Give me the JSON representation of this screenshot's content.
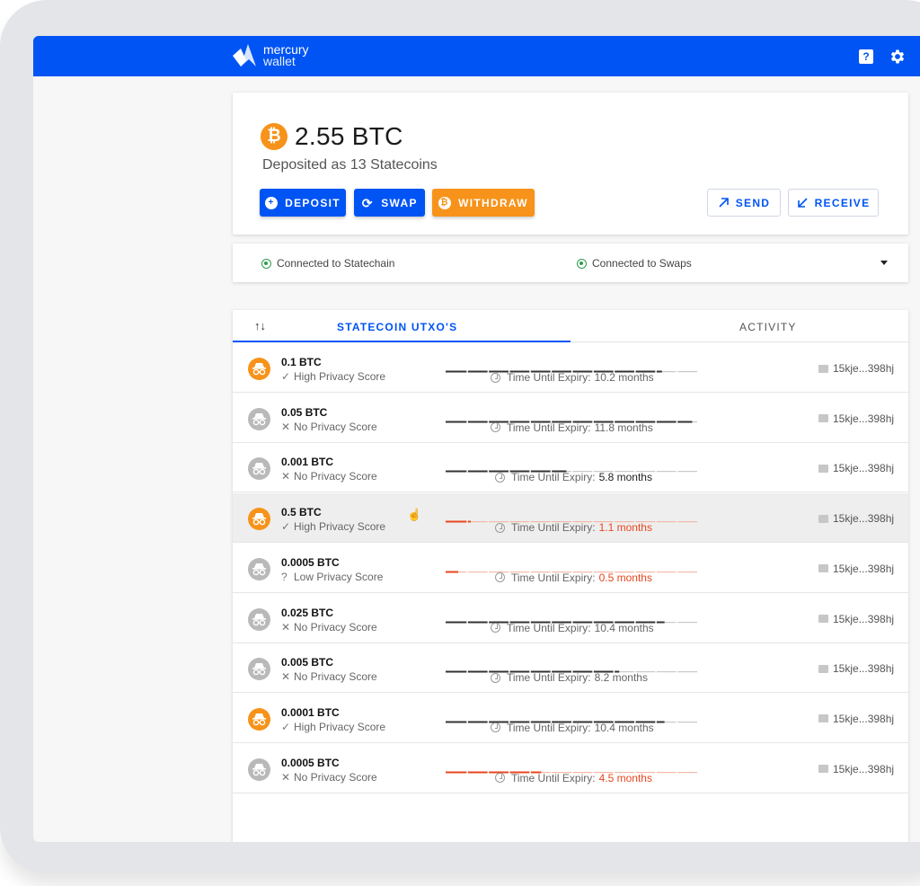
{
  "app": {
    "logo_line1": "mercury",
    "logo_line2": "wallet",
    "help_label": "?"
  },
  "balance": {
    "amount": "2.55 BTC",
    "subtitle": "Deposited as 13 Statecoins",
    "btc_symbol": "₿"
  },
  "actions": {
    "deposit": "DEPOSIT",
    "swap": "SWAP",
    "withdraw": "WITHDRAW",
    "send": "SEND",
    "receive": "RECEIVE"
  },
  "status": {
    "statechain": "Connected to Statechain",
    "swaps": "Connected to Swaps"
  },
  "tabs": {
    "sort_icon": "↑↓",
    "utxo": "STATECOIN UTXO'S",
    "activity": "ACTIVITY"
  },
  "expiry_label": "Time Until Expiry:",
  "coins": [
    {
      "amount": "0.1 BTC",
      "privacy_icon": "✓",
      "privacy": "High Privacy Score",
      "icon_color": "orange",
      "expiry": "10.2 months",
      "expiry_style": "normal",
      "progress": 0.86,
      "bar_color": "dark",
      "address": "15kje...398hj"
    },
    {
      "amount": "0.05 BTC",
      "privacy_icon": "✕",
      "privacy": "No Privacy Score",
      "icon_color": "grey",
      "expiry": "11.8 months",
      "expiry_style": "normal",
      "progress": 0.98,
      "bar_color": "dark",
      "address": "15kje...398hj"
    },
    {
      "amount": "0.001 BTC",
      "privacy_icon": "✕",
      "privacy": "No Privacy Score",
      "icon_color": "grey",
      "expiry": "5.8 months",
      "expiry_style": "dark",
      "progress": 0.48,
      "bar_color": "dark",
      "address": "15kje...398hj"
    },
    {
      "amount": "0.5 BTC",
      "privacy_icon": "✓",
      "privacy": "High Privacy Score",
      "icon_color": "orange",
      "expiry": "1.1 months",
      "expiry_style": "red",
      "progress": 0.1,
      "bar_color": "red",
      "address": "15kje...398hj",
      "highlight": true
    },
    {
      "amount": "0.0005 BTC",
      "privacy_icon": "?",
      "privacy": "Low Privacy Score",
      "icon_color": "grey",
      "expiry": "0.5 months",
      "expiry_style": "red",
      "progress": 0.05,
      "bar_color": "red",
      "address": "15kje...398hj"
    },
    {
      "amount": "0.025 BTC",
      "privacy_icon": "✕",
      "privacy": "No Privacy Score",
      "icon_color": "grey",
      "expiry": "10.4 months",
      "expiry_style": "normal",
      "progress": 0.87,
      "bar_color": "dark",
      "address": "15kje...398hj"
    },
    {
      "amount": "0.005 BTC",
      "privacy_icon": "✕",
      "privacy": "No Privacy Score",
      "icon_color": "grey",
      "expiry": "8.2 months",
      "expiry_style": "normal",
      "progress": 0.69,
      "bar_color": "dark",
      "address": "15kje...398hj"
    },
    {
      "amount": "0.0001 BTC",
      "privacy_icon": "✓",
      "privacy": "High Privacy Score",
      "icon_color": "orange",
      "expiry": "10.4 months",
      "expiry_style": "normal",
      "progress": 0.87,
      "bar_color": "dark",
      "address": "15kje...398hj"
    },
    {
      "amount": "0.0005 BTC",
      "privacy_icon": "✕",
      "privacy": "No Privacy Score",
      "icon_color": "grey",
      "expiry": "4.5 months",
      "expiry_style": "red",
      "progress": 0.38,
      "bar_color": "red",
      "address": "15kje...398hj"
    }
  ],
  "colors": {
    "primary": "#0054f4",
    "bitcoin_orange": "#f7931a",
    "connected_green": "#2e9c4b",
    "warning_red": "#e8461e"
  }
}
